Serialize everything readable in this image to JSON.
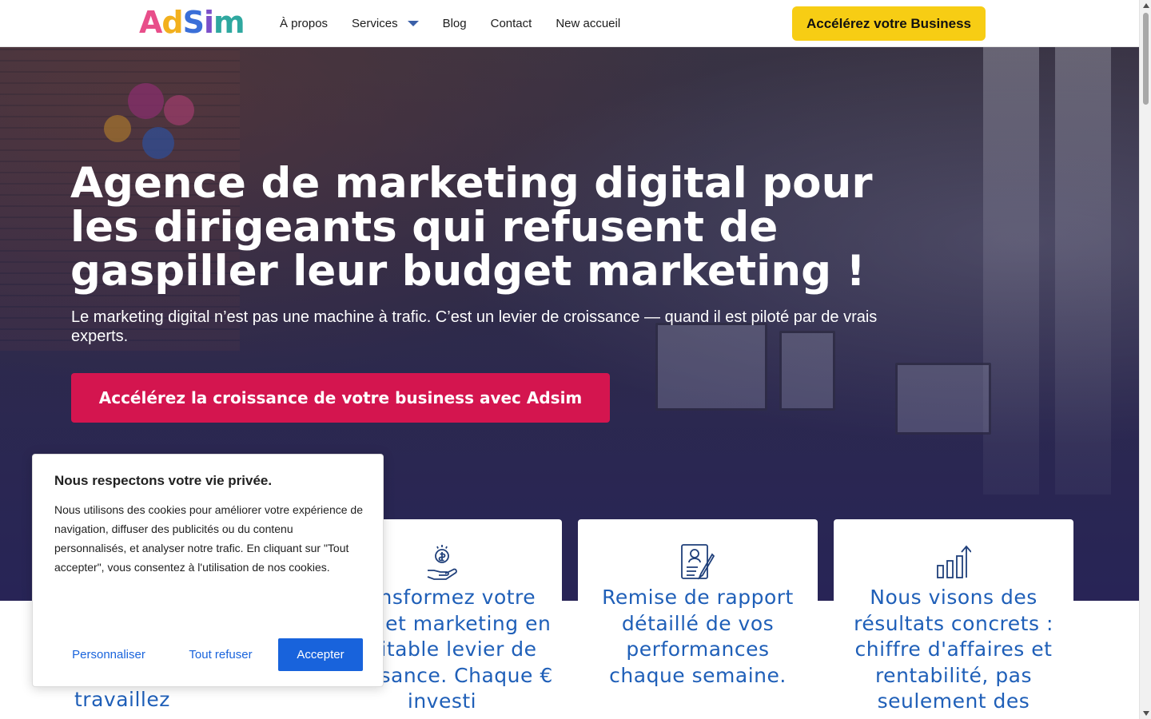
{
  "header": {
    "logo_text": "AdSim",
    "nav": [
      "À propos",
      "Services",
      "Blog",
      "Contact",
      "New accueil"
    ],
    "cta_label": "Accélérez votre Business"
  },
  "hero": {
    "title": "Agence de marketing digital pour les dirigeants qui refusent de gaspiller leur budget marketing !",
    "subtitle": "Le marketing digital n’est pas une machine à trafic. C’est un levier de croissance — quand il est piloté par de vrais experts.",
    "cta_label": "Accélérez la croissance de votre business avec Adsim"
  },
  "cards": [
    {
      "icon": "hand-coin-icon",
      "text": "Transformez votre budget marketing en véritable levier de croissance. Chaque € investi"
    },
    {
      "icon": "report-icon",
      "text": "Remise de rapport détaillé de vos performances chaque semaine."
    },
    {
      "icon": "growth-chart-icon",
      "text": "Nous visons des résultats concrets : chiffre d'affaires et rentabilité, pas seulement des"
    }
  ],
  "card_left_visible_text": "travaillez",
  "cookie": {
    "title": "Nous respectons votre vie privée.",
    "body": "Nous utilisons des cookies pour améliorer votre expérience de navigation, diffuser des publicités ou du contenu personnalisés, et analyser notre trafic. En cliquant sur \"Tout accepter\", vous consentez à l'utilisation de nos cookies.",
    "customize_label": "Personnaliser",
    "refuse_label": "Tout refuser",
    "accept_label": "Accepter"
  },
  "colors": {
    "header_cta": "#f7cd14",
    "hero_cta": "#d4154f",
    "card_text": "#1f5fb8",
    "cookie_primary": "#1863dc"
  }
}
